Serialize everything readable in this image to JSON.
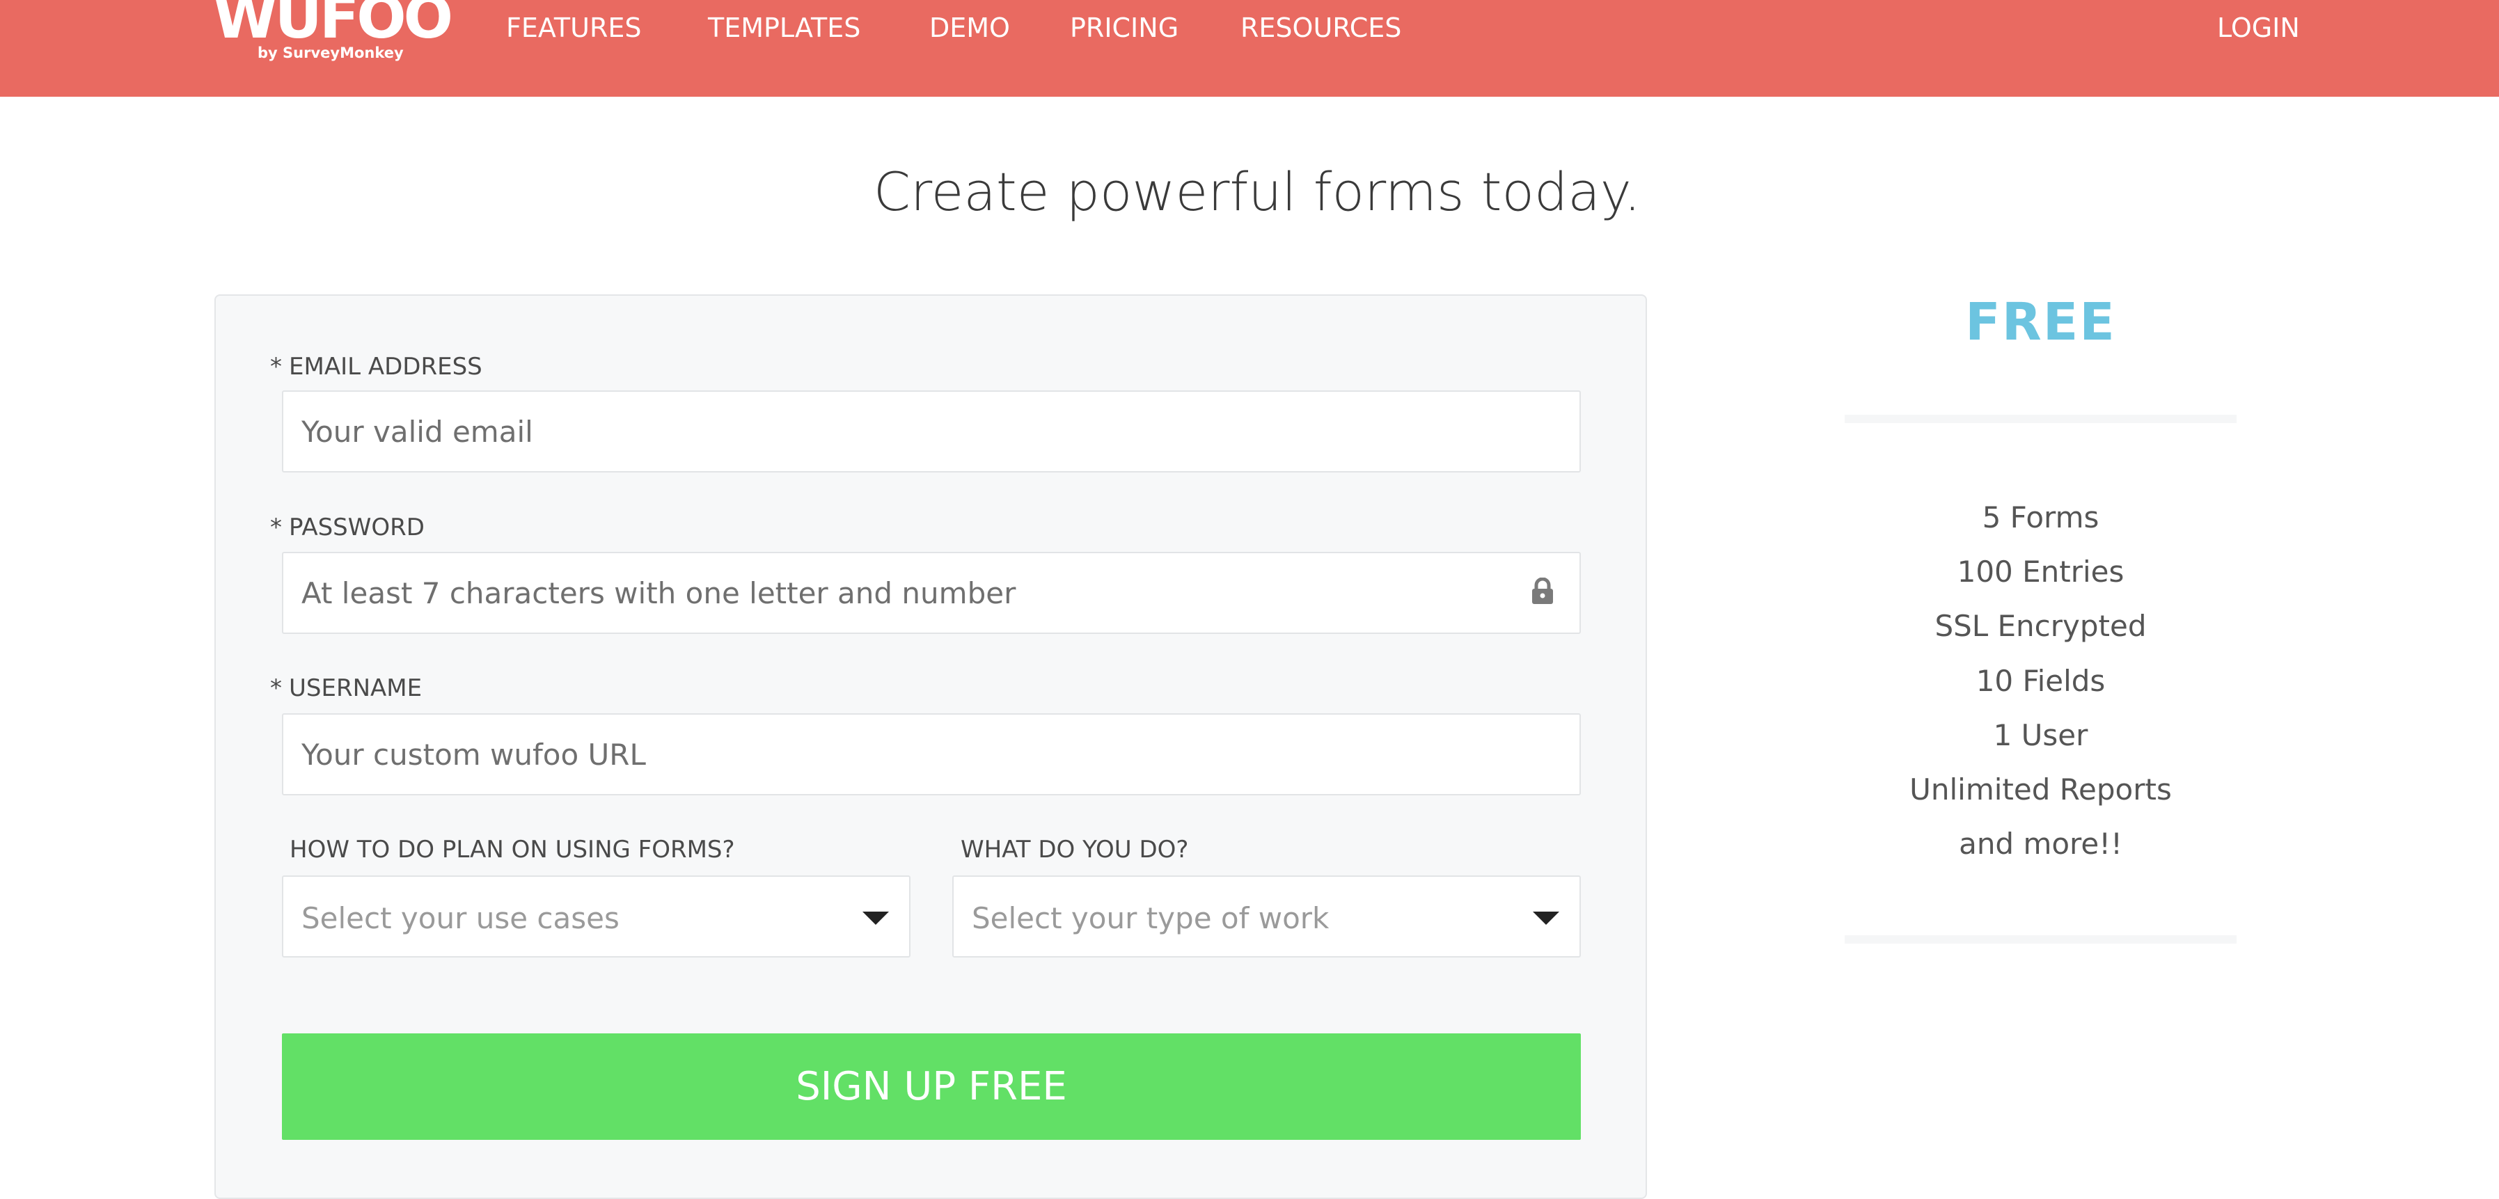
{
  "brand": {
    "logo_text": "WUFOO",
    "tagline": "by SurveyMonkey",
    "header_color": "#e96a61"
  },
  "nav": {
    "items": [
      {
        "label": "FEATURES"
      },
      {
        "label": "TEMPLATES"
      },
      {
        "label": "DEMO"
      },
      {
        "label": "PRICING"
      },
      {
        "label": "RESOURCES"
      }
    ],
    "login_label": "LOGIN"
  },
  "headline": "Create powerful forms today.",
  "form": {
    "required_marker": "*",
    "email": {
      "label": "EMAIL ADDRESS",
      "placeholder": "Your valid email",
      "value": ""
    },
    "password": {
      "label": "PASSWORD",
      "placeholder": "At least 7 characters with one letter and number",
      "value": "",
      "icon": "lock-icon"
    },
    "username": {
      "label": "USERNAME",
      "placeholder": "Your custom wufoo URL",
      "value": ""
    },
    "use_case": {
      "label": "HOW TO DO PLAN ON USING FORMS?",
      "selected": "Select your use cases",
      "icon": "chevron-down-icon"
    },
    "work_type": {
      "label": "WHAT DO YOU DO?",
      "selected": "Select your type of work",
      "icon": "chevron-down-icon"
    },
    "submit_label": "SIGN UP FREE",
    "submit_color": "#62e066"
  },
  "plan": {
    "name": "FREE",
    "name_color": "#6cc4e0",
    "features": [
      "5 Forms",
      "100 Entries",
      "SSL Encrypted",
      "10 Fields",
      "1 User",
      "Unlimited Reports",
      "and more!!"
    ]
  }
}
